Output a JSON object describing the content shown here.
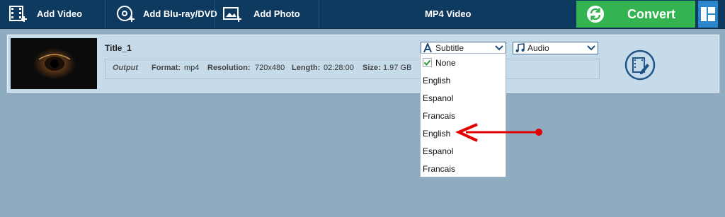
{
  "toolbar": {
    "add_video": "Add Video",
    "add_bluray": "Add Blu-ray/DVD",
    "add_photo": "Add Photo",
    "format": "MP4 Video",
    "convert": "Convert"
  },
  "item": {
    "title": "Title_1",
    "output_label": "Output",
    "format_label": "Format:",
    "format_value": "mp4",
    "resolution_label": "Resolution:",
    "resolution_value": "720x480",
    "length_label": "Length:",
    "length_value": "02:28:00",
    "size_label": "Size:",
    "size_value": "1.97 GB"
  },
  "subtitle_select": {
    "selected": "Subtitle"
  },
  "audio_select": {
    "selected": "Audio"
  },
  "subtitle_menu": {
    "items": [
      "None",
      "English",
      "Espanol",
      "Francais",
      "English",
      "Espanol",
      "Francais"
    ],
    "checked_index": 0
  },
  "colors": {
    "toolbar_bg": "#0f3a60",
    "convert_green": "#33b450",
    "annotation_red": "#e30000"
  }
}
